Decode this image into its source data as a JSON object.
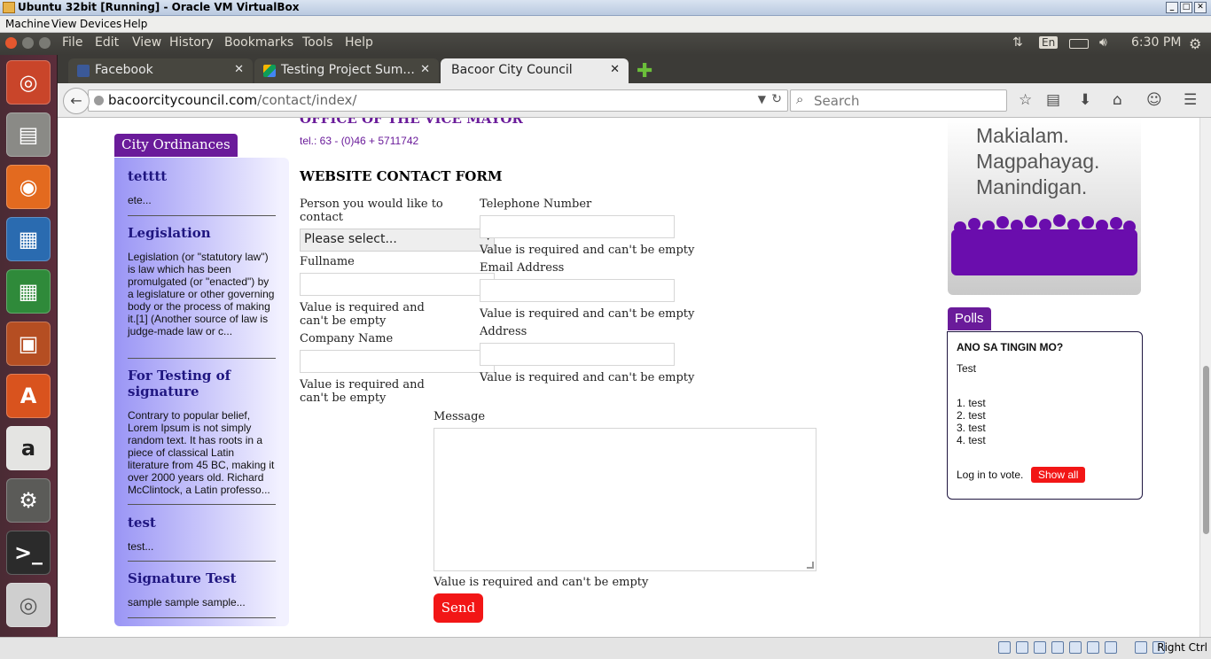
{
  "window": {
    "title": "Ubuntu 32bit [Running] - Oracle VM VirtualBox"
  },
  "vbox_menu": [
    "Machine",
    "View",
    "Devices",
    "Help"
  ],
  "ubuntu_panel": {
    "menu": [
      "File",
      "Edit",
      "View",
      "History",
      "Bookmarks",
      "Tools",
      "Help"
    ],
    "keyboard": "En",
    "time": "6:30 PM"
  },
  "tabs": [
    {
      "label": "Facebook"
    },
    {
      "label": "Testing Project Sum..."
    },
    {
      "label": "Bacoor City Council"
    }
  ],
  "address": {
    "host": "bacoorcitycouncil.com",
    "path": "/contact/index/"
  },
  "search": {
    "placeholder": "Search"
  },
  "sidebar": {
    "title": "City Ordinances",
    "items": [
      {
        "title": "tetttt",
        "text": "ete..."
      },
      {
        "title": "Legislation",
        "text": "Legislation (or \"statutory law\") is law which has been promulgated (or \"enacted\") by a legislature or other governing body or the process of making it.[1] (Another source of law is judge-made law or c..."
      },
      {
        "title": "For Testing of signature",
        "text": "Contrary to popular belief, Lorem Ipsum is not simply random text. It has roots in a piece of classical Latin literature from 45 BC, making it over 2000 years old. Richard McClintock, a Latin professo..."
      },
      {
        "title": "test",
        "text": "test..."
      },
      {
        "title": "Signature Test",
        "text": "sample sample sample..."
      }
    ]
  },
  "main": {
    "office": "OFFICE OF THE VICE MAYOR",
    "tel": "tel.: 63 - (0)46 + 5711742",
    "form_title": "WEBSITE CONTACT FORM",
    "fields": {
      "person_label": "Person you would like to contact",
      "person_value": "Please select...",
      "telephone_label": "Telephone Number",
      "fullname_label": "Fullname",
      "email_label": "Email Address",
      "company_label": "Company Name",
      "address_label": "Address",
      "message_label": "Message"
    },
    "error": "Value is required and can't be empty",
    "send": "Send"
  },
  "banner": {
    "lines": [
      "Makialam.",
      "Magpahayag.",
      "Manindigan."
    ]
  },
  "polls": {
    "title": "Polls",
    "question": "ANO SA TINGIN MO?",
    "description": "Test",
    "options": [
      "1. test",
      "2. test",
      "3. test",
      "4. test"
    ],
    "login": "Log in to vote.",
    "show_all": "Show all"
  },
  "statusbar": {
    "host_key": "Right Ctrl"
  }
}
